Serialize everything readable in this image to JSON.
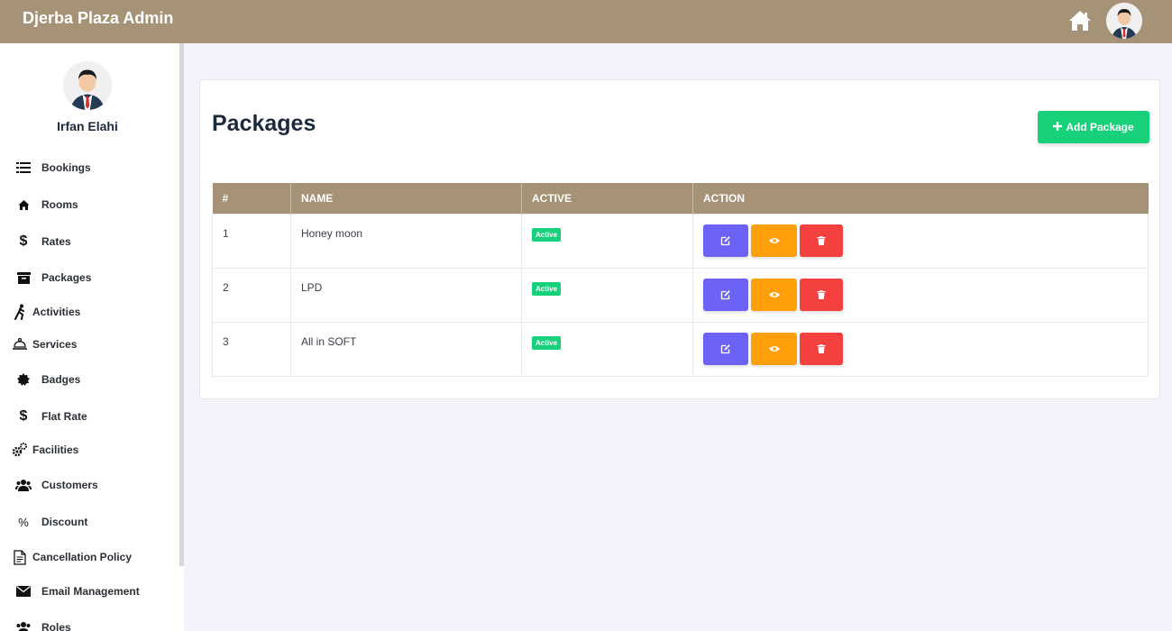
{
  "header": {
    "brand": "Djerba Plaza Admin",
    "icons": [
      "home-icon",
      "user-avatar"
    ]
  },
  "sidebar": {
    "user_name": "Irfan Elahi",
    "items": [
      {
        "label": "Bookings",
        "icon": "list-icon"
      },
      {
        "label": "Rooms",
        "icon": "home-icon"
      },
      {
        "label": "Rates",
        "icon": "dollar-icon"
      },
      {
        "label": "Packages",
        "icon": "archive-icon"
      },
      {
        "label": "Activities",
        "icon": "running-icon"
      },
      {
        "label": "Services",
        "icon": "service-bell-icon"
      },
      {
        "label": "Badges",
        "icon": "badge-icon"
      },
      {
        "label": "Flat Rate",
        "icon": "dollar-icon"
      },
      {
        "label": "Facilities",
        "icon": "cogs-icon"
      },
      {
        "label": "Customers",
        "icon": "users-icon"
      },
      {
        "label": "Discount",
        "icon": "percent-icon"
      },
      {
        "label": "Cancellation Policy",
        "icon": "document-icon"
      },
      {
        "label": "Email Management",
        "icon": "envelope-icon"
      },
      {
        "label": "Roles",
        "icon": "users-icon"
      }
    ]
  },
  "main": {
    "title": "Packages",
    "add_button": "Add Package",
    "table": {
      "columns": [
        "#",
        "NAME",
        "ACTIVE",
        "ACTION"
      ],
      "rows": [
        {
          "num": "1",
          "name": "Honey moon",
          "status": "Active"
        },
        {
          "num": "2",
          "name": "LPD",
          "status": "Active"
        },
        {
          "num": "3",
          "name": "All in SOFT",
          "status": "Active"
        }
      ]
    }
  },
  "colors": {
    "header": "#a69277",
    "add_button": "#16d17a",
    "edit": "#6c63f6",
    "view": "#ff9f0a",
    "delete": "#f54040"
  }
}
